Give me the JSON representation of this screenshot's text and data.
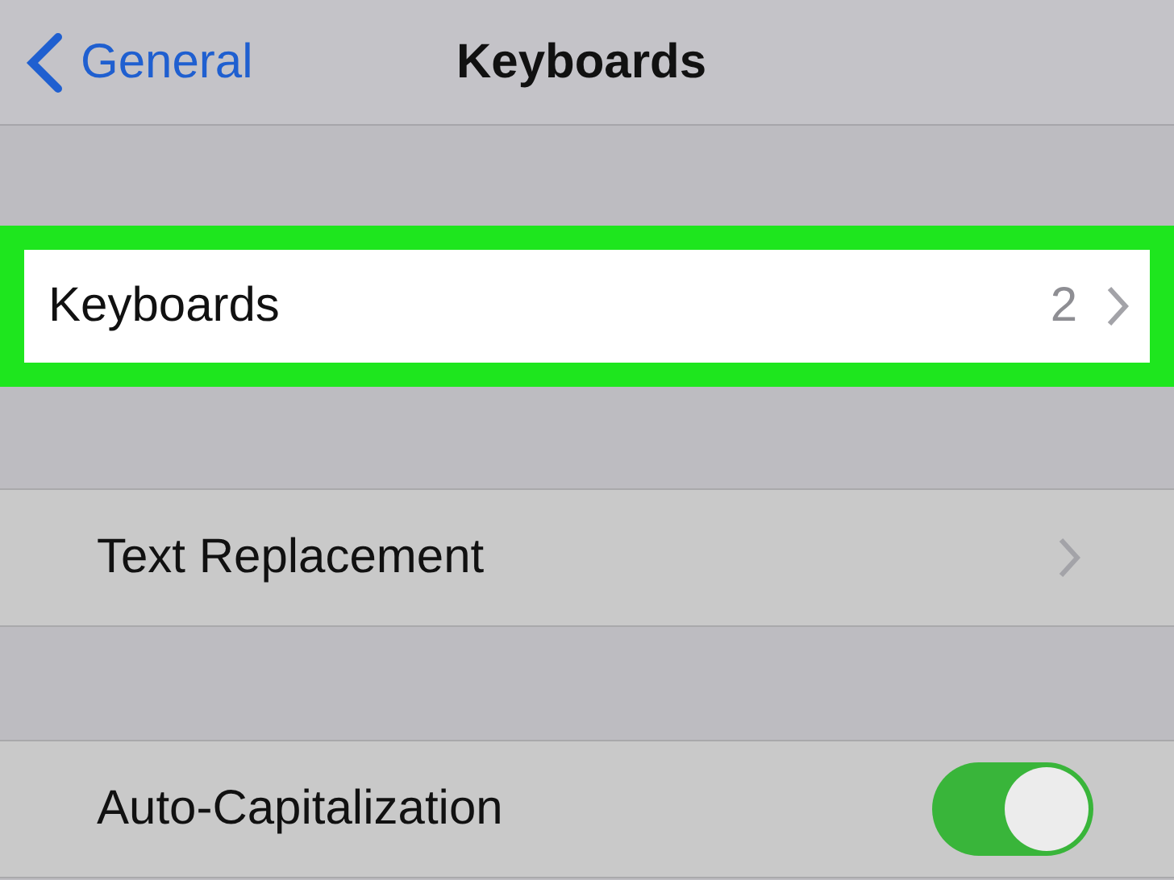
{
  "nav_bar": {
    "back_label": "General",
    "title": "Keyboards"
  },
  "rows": [
    {
      "kind": "link",
      "label": "Keyboards",
      "value": "2",
      "highlighted": true
    },
    {
      "kind": "link",
      "label": "Text Replacement",
      "highlighted": false
    },
    {
      "kind": "toggle",
      "label": "Auto-Capitalization",
      "on": true,
      "highlighted": false
    }
  ]
}
